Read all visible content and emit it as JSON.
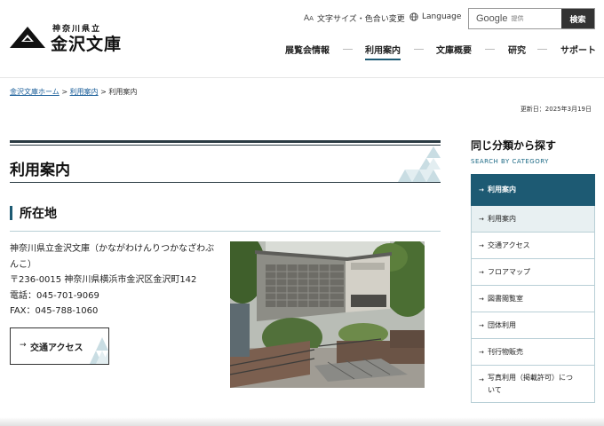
{
  "header": {
    "logo_sub": "神奈川県立",
    "logo_main": "金沢文庫",
    "font_size_label": "文字サイズ・色合い変更",
    "language_label": "Language",
    "search_brand": "Google",
    "search_sub": "提供",
    "search_button": "検索"
  },
  "gnav": [
    {
      "label": "展覧会情報"
    },
    {
      "label": "利用案内"
    },
    {
      "label": "文庫概要"
    },
    {
      "label": "研究"
    },
    {
      "label": "サポート"
    }
  ],
  "breadcrumb": {
    "home": "金沢文庫ホーム",
    "sep": ">",
    "parent": "利用案内",
    "current": "利用案内"
  },
  "updated": "更新日：2025年3月19日",
  "main": {
    "title": "利用案内",
    "section_title": "所在地",
    "address_lines": [
      "神奈川県立金沢文庫（かながわけんりつかなざわぶんこ）",
      "〒236-0015 神奈川県横浜市金沢区金沢町142",
      "電話：045-701-9069",
      "FAX：045-788-1060"
    ],
    "access_button": "交通アクセス"
  },
  "side": {
    "title": "同じ分類から探す",
    "subtitle": "SEARCH BY CATEGORY",
    "head": "利用案内",
    "items": [
      {
        "label": "利用案内"
      },
      {
        "label": "交通アクセス"
      },
      {
        "label": "フロアマップ"
      },
      {
        "label": "図書閲覧室"
      },
      {
        "label": "団体利用"
      },
      {
        "label": "刊行物販売"
      },
      {
        "label": "写真利用（掲載許可）について"
      }
    ]
  },
  "colors": {
    "accent": "#1d5a73",
    "link": "#1a5e99",
    "border": "#b8cfd6"
  }
}
